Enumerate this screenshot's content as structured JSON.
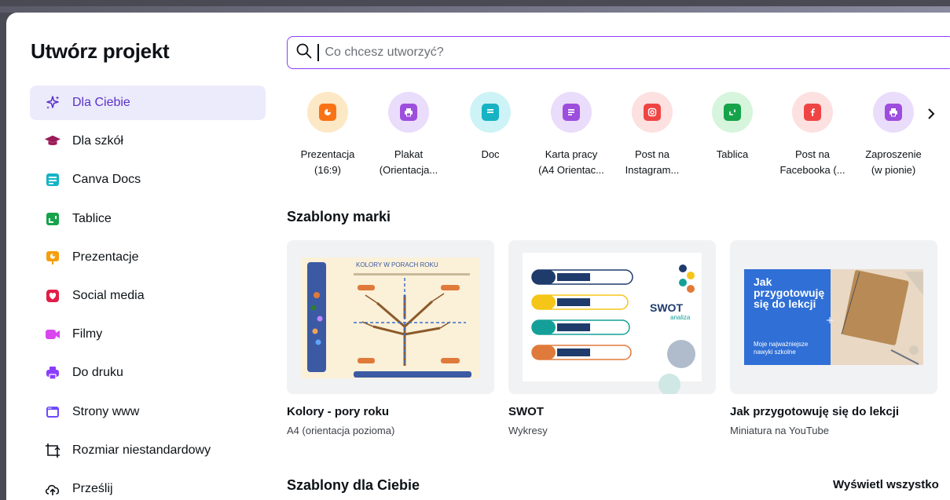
{
  "sidebar": {
    "title": "Utwórz projekt",
    "items": [
      {
        "label": "Dla Ciebie",
        "icon": "sparkle-icon",
        "color": "#5a32c8",
        "active": true
      },
      {
        "label": "Dla szkół",
        "icon": "graduation-cap-icon",
        "color": "#9b1b5a"
      },
      {
        "label": "Canva Docs",
        "icon": "docs-icon",
        "color": "#17b3c4"
      },
      {
        "label": "Tablice",
        "icon": "whiteboard-icon",
        "color": "#16a34a"
      },
      {
        "label": "Prezentacje",
        "icon": "presentation-icon",
        "color": "#f59e0b"
      },
      {
        "label": "Social media",
        "icon": "heart-icon",
        "color": "#e11d48"
      },
      {
        "label": "Filmy",
        "icon": "video-icon",
        "color": "#d946ef"
      },
      {
        "label": "Do druku",
        "icon": "printer-icon",
        "color": "#8b3dff"
      },
      {
        "label": "Strony www",
        "icon": "website-icon",
        "color": "#6d4aff"
      },
      {
        "label": "Rozmiar niestandardowy",
        "icon": "custom-size-icon",
        "color": "#0d1216"
      },
      {
        "label": "Prześlij",
        "icon": "upload-cloud-icon",
        "color": "#0d1216"
      }
    ]
  },
  "search": {
    "placeholder": "Co chcesz utworzyć?"
  },
  "categories": [
    {
      "label1": "Prezentacja",
      "label2": "(16:9)",
      "bg": "#fde8c6",
      "fg": "#f97316",
      "icon": "presentation-icon"
    },
    {
      "label1": "Plakat",
      "label2": "(Orientacja...",
      "bg": "#eadcfb",
      "fg": "#9d4edd",
      "icon": "printer-icon"
    },
    {
      "label1": "Doc",
      "label2": "",
      "bg": "#cdf3f6",
      "fg": "#17b3c4",
      "icon": "docs-icon"
    },
    {
      "label1": "Karta pracy",
      "label2": "(A4 Orientac...",
      "bg": "#eadcfb",
      "fg": "#9d4edd",
      "icon": "document-icon"
    },
    {
      "label1": "Post na",
      "label2": "Instagram...",
      "bg": "#fde0e0",
      "fg": "#ef4444",
      "icon": "instagram-icon"
    },
    {
      "label1": "Tablica",
      "label2": "",
      "bg": "#d6f5dc",
      "fg": "#16a34a",
      "icon": "whiteboard-icon"
    },
    {
      "label1": "Post na",
      "label2": "Facebooka (...",
      "bg": "#fde0e0",
      "fg": "#ef4444",
      "icon": "facebook-icon"
    },
    {
      "label1": "Zaproszenie",
      "label2": "(w pionie)",
      "bg": "#eadcfb",
      "fg": "#9d4edd",
      "icon": "printer-icon"
    }
  ],
  "brand_section": {
    "title": "Szablony marki"
  },
  "templates": [
    {
      "title": "Kolory - pory roku",
      "subtitle": "A4 (orientacja pozioma)",
      "thumb_heading": "KOLORY W PORACH ROKU"
    },
    {
      "title": "SWOT",
      "subtitle": "Wykresy",
      "thumb_heading": "SWOT",
      "thumb_sub": "analiza"
    },
    {
      "title": "Jak przygotowuję się do lekcji",
      "subtitle": "Miniatura na YouTube",
      "thumb_heading": "Jak przygotowuję się do lekcji",
      "thumb_sub": "Moje najważniejsze nawyki szkolne"
    }
  ],
  "for_you_section": {
    "title": "Szablony dla Ciebie",
    "view_all": "Wyświetl wszystko"
  }
}
